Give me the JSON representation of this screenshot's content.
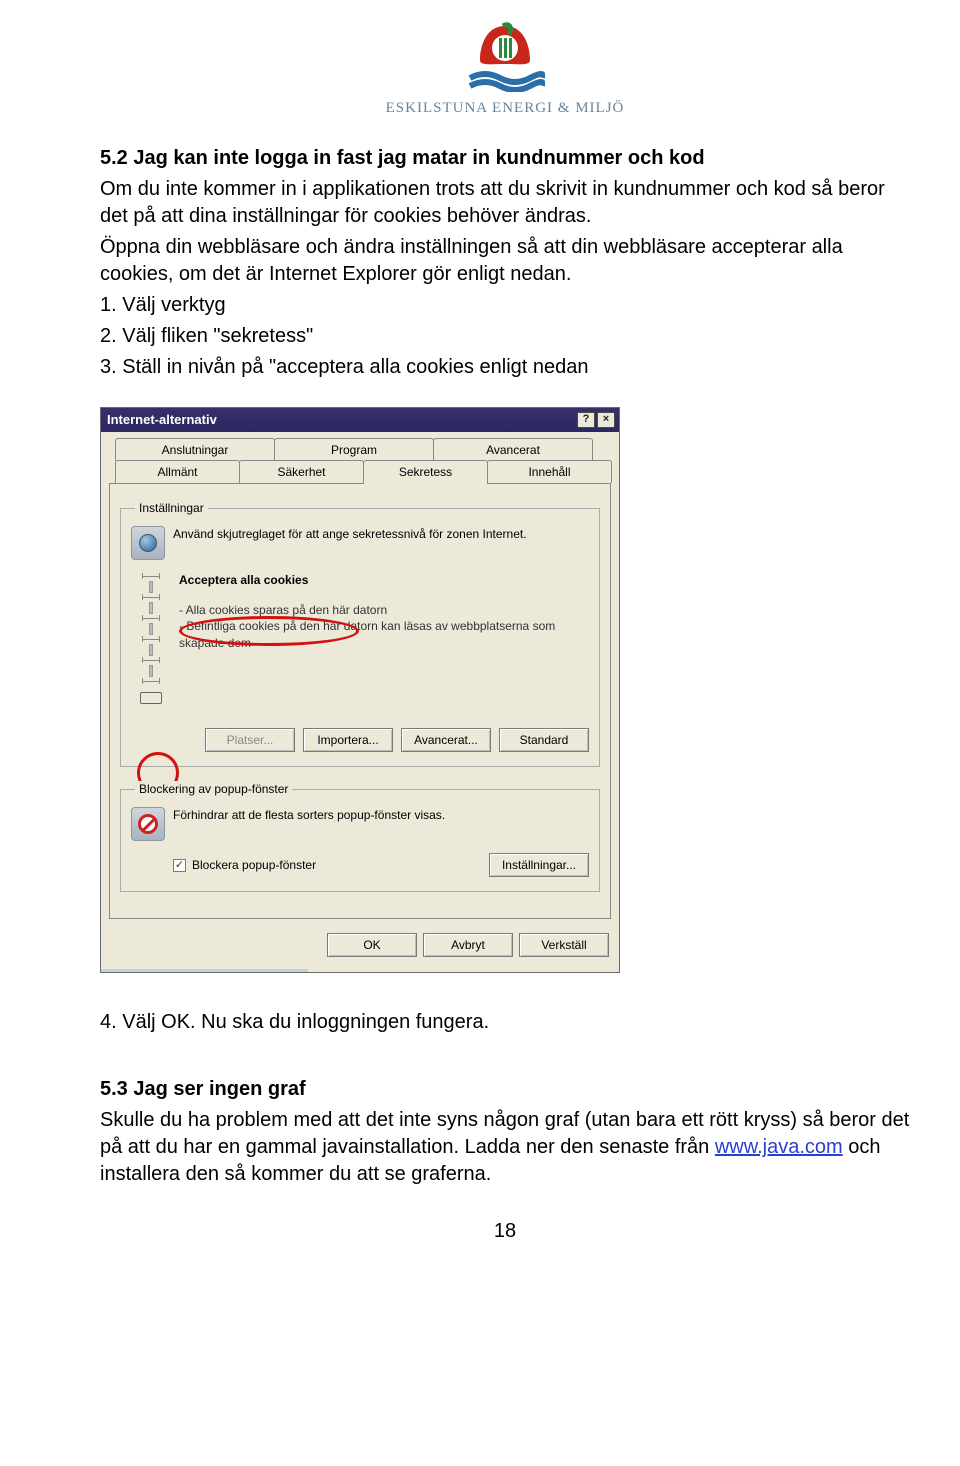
{
  "header": {
    "brand": "ESKILSTUNA ENERGI & MILJÖ"
  },
  "section1": {
    "heading": "5.2 Jag kan inte logga in fast jag matar in kundnummer och kod",
    "p1": "Om du inte kommer in i applikationen trots att du skrivit in kundnummer och kod så beror det på att dina inställningar för cookies behöver ändras.",
    "p2": "Öppna din webbläsare och ändra inställningen så att din webbläsare accepterar alla cookies, om det är Internet Explorer gör enligt nedan.",
    "step1": "1. Välj verktyg",
    "step2": "2. Välj fliken \"sekretess\"",
    "step3": "3. Ställ in nivån på \"acceptera alla cookies enligt nedan",
    "step4": "4. Välj OK. Nu ska du inloggningen fungera."
  },
  "dialog": {
    "title": "Internet-alternativ",
    "tabs_row1": [
      "Anslutningar",
      "Program",
      "Avancerat"
    ],
    "tabs_row2": [
      "Allmänt",
      "Säkerhet",
      "Sekretess",
      "Innehåll"
    ],
    "active_tab": "Sekretess",
    "group_settings": {
      "legend": "Inställningar",
      "intro": "Använd skjutreglaget för att ange sekretessnivå för zonen Internet.",
      "level_name": "Acceptera alla cookies",
      "bullets": [
        "Alla cookies sparas på den här datorn",
        "Befintliga cookies på den här datorn kan läsas av webbplatserna som skapade dem"
      ],
      "btn_sites": "Platser...",
      "btn_import": "Importera...",
      "btn_advanced": "Avancerat...",
      "btn_default": "Standard"
    },
    "group_popup": {
      "legend": "Blockering av popup-fönster",
      "desc": "Förhindrar att de flesta sorters popup-fönster visas.",
      "checkbox_label": "Blockera popup-fönster",
      "btn_settings": "Inställningar..."
    },
    "bottom_buttons": {
      "ok": "OK",
      "cancel": "Avbryt",
      "apply": "Verkställ"
    }
  },
  "section2": {
    "heading": "5.3 Jag ser ingen graf",
    "line1a": "Skulle du ha problem med att det inte syns någon graf (utan bara ett rött kryss) så beror det på att du har en gammal javainstallation. Ladda ner den senaste från ",
    "link_text": "www.java.com",
    "line1b": " och installera den så kommer du att se graferna."
  },
  "page_number": "18"
}
